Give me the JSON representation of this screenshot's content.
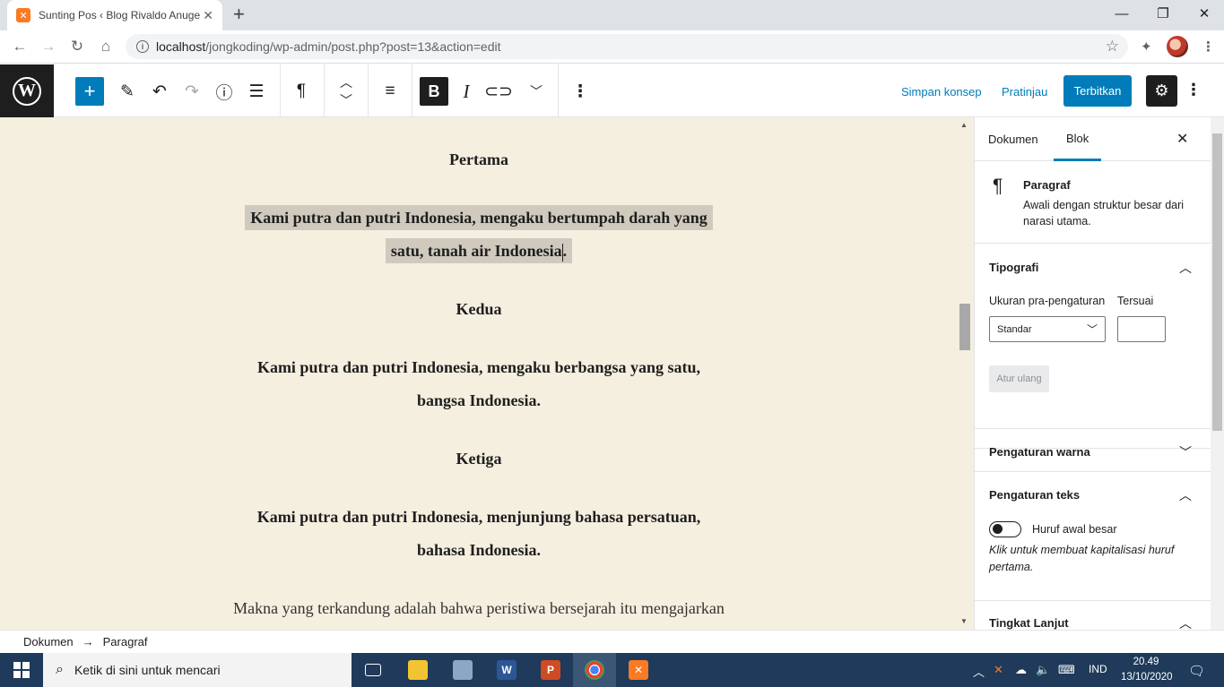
{
  "browser": {
    "tab_title": "Sunting Pos ‹ Blog Rivaldo Anuge",
    "tab_favicon_letter": "✕",
    "url_host": "localhost",
    "url_path": "/jongkoding/wp-admin/post.php?post=13&action=edit"
  },
  "wp_header": {
    "save_draft": "Simpan konsep",
    "preview": "Pratinjau",
    "publish": "Terbitkan"
  },
  "content": {
    "heading1": "Pertama",
    "para1_line1": "Kami putra dan putri Indonesia, mengaku bertumpah darah yang",
    "para1_line2": "satu, tanah air Indonesia",
    "para1_end": ".",
    "heading2": "Kedua",
    "para2_line1": "Kami putra dan putri Indonesia, mengaku berbangsa yang satu,",
    "para2_line2": "bangsa Indonesia.",
    "heading3": "Ketiga",
    "para3_line1": "Kami putra dan putri Indonesia, menjunjung bahasa persatuan,",
    "para3_line2": "bahasa Indonesia.",
    "para4_line1": "Makna yang terkandung adalah bahwa peristiwa bersejarah itu mengajarkan"
  },
  "sidebar": {
    "tab_document": "Dokumen",
    "tab_block": "Blok",
    "block_name": "Paragraf",
    "block_desc": "Awali dengan struktur besar dari narasi utama.",
    "typography_title": "Tipografi",
    "preset_size_label": "Ukuran pra-pengaturan",
    "custom_label": "Tersuai",
    "preset_value": "Standar",
    "reset_button": "Atur ulang",
    "color_settings": "Pengaturan warna",
    "text_settings": "Pengaturan teks",
    "dropcap_label": "Huruf awal besar",
    "dropcap_hint": "Klik untuk membuat kapitalisasi huruf pertama.",
    "advanced": "Tingkat Lanjut"
  },
  "breadcrumb": {
    "root": "Dokumen",
    "arrow": "→",
    "current": "Paragraf"
  },
  "taskbar": {
    "search_placeholder": "Ketik di sini untuk mencari",
    "lang": "IND",
    "time": "20.49",
    "date": "13/10/2020"
  },
  "colors": {
    "wp_blue": "#007cba",
    "canvas_bg": "#f5efe0",
    "selection_highlight": "#cfcabd",
    "taskbar_bg": "#1f3a5a"
  }
}
